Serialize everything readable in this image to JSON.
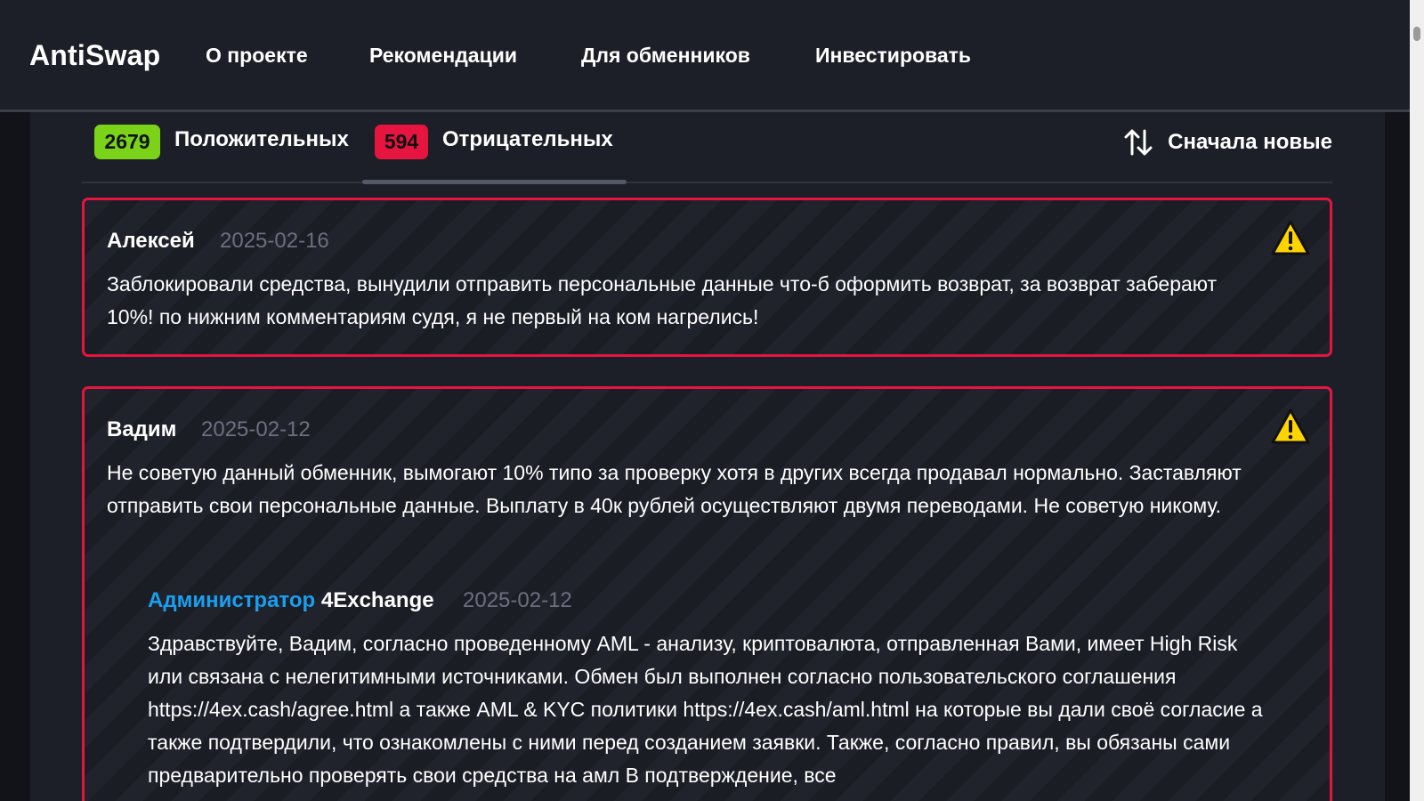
{
  "header": {
    "logo": "AntiSwap",
    "nav": [
      "О проекте",
      "Рекомендации",
      "Для обменников",
      "Инвестировать"
    ]
  },
  "filters": {
    "positive": {
      "count": "2679",
      "label": "Положительных",
      "color": "#7ad319"
    },
    "negative": {
      "count": "594",
      "label": "Отрицательных",
      "color": "#e5153f"
    },
    "sort_label": "Сначала новые",
    "sort_icon": "sort-arrows-icon"
  },
  "reviews": [
    {
      "author": "Алексей",
      "date": "2025-02-16",
      "icon": "warning-icon",
      "text": "Заблокировали средства, вынудили отправить персональные данные что-б оформить возврат, за возврат заберают 10%! по нижним комментариям судя, я не первый на ком нагрелись!"
    },
    {
      "author": "Вадим",
      "date": "2025-02-12",
      "icon": "warning-icon",
      "text": "Не советую данный обменник, вымогают 10% типо за проверку хотя в других всегда продавал нормально. Заставляют отправить свои персональные данные. Выплату в 40к рублей осуществляют двумя переводами. Не советую никому.",
      "reply": {
        "role": "Администратор",
        "name": "4Exchange",
        "date": "2025-02-12",
        "text": "Здравствуйте, Вадим, согласно проведенному AML - анализу, криптовалюта, отправленная Вами, имеет High Risk или связана с нелегитимными источниками. Обмен был выполнен согласно пользовательского соглашения https://4ex.cash/agree.html а также AML & KYC политики https://4ex.cash/aml.html на которые вы дали своё согласие а также подтвердили, что ознакомлены с ними перед созданием заявки. Также, согласно правил, вы обязаны сами предварительно проверять свои средства на амл В подтверждение, все"
      }
    }
  ],
  "colors": {
    "accent_admin": "#1a9ff0",
    "negative_border": "#e5153f",
    "warning_yellow": "#ffd400"
  }
}
